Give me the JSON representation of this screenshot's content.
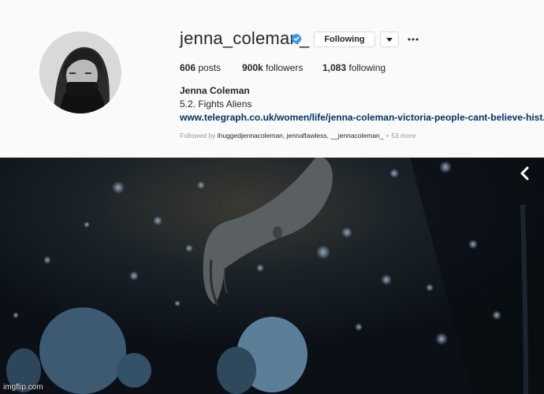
{
  "profile": {
    "username": "jenna_coleman_",
    "verified": true,
    "following_label": "Following",
    "stats": {
      "posts_count": "606",
      "posts_label": "posts",
      "followers_count": "900k",
      "followers_label": "followers",
      "following_count": "1,083",
      "following_label": "following"
    },
    "full_name": "Jenna Coleman",
    "bio": "5.2. Fights Aliens",
    "link": "www.telegraph.co.uk/women/life/jenna-coleman-victoria-people-cant-believe-hist...",
    "followed_by_prefix": "Followed by",
    "followed_by_names": "ihuggedjennacoleman, jennaflawless, __jennacoleman_",
    "followed_by_more": "+ 53 more"
  },
  "media": {
    "icons": [
      "chevron-left-icon"
    ]
  },
  "watermark": "imgflip.com",
  "colors": {
    "link": "#003569",
    "verified": "#3897f0",
    "panel_bg": "#fafafa",
    "border": "#dbdbdb"
  }
}
